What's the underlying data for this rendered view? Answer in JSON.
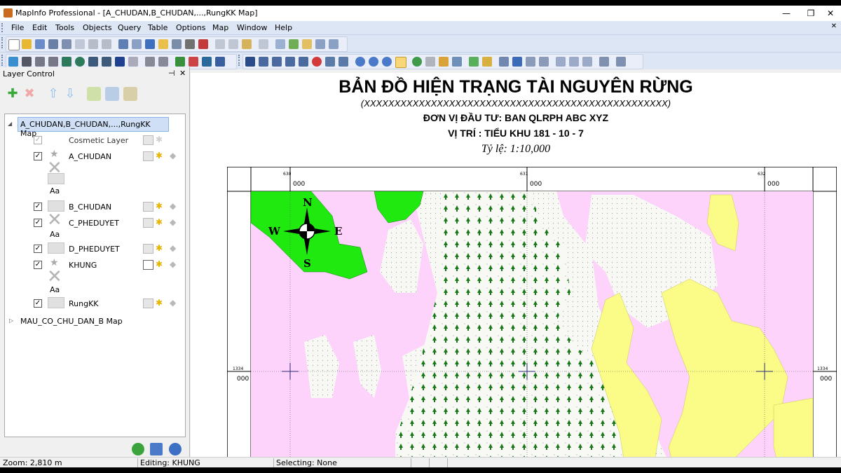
{
  "window": {
    "title": "MapInfo Professional - [A_CHUDAN,B_CHUDAN,...,RungKK Map]",
    "controls": [
      "—",
      "❐",
      "✕"
    ]
  },
  "menu": {
    "items": [
      "File",
      "Edit",
      "Tools",
      "Objects",
      "Query",
      "Table",
      "Options",
      "Map",
      "Window",
      "Help"
    ],
    "mdi_close": "✕"
  },
  "layer_control": {
    "title": "Layer Control",
    "pin": "⊣",
    "close": "✕",
    "map_node": "A_CHUDAN,B_CHUDAN,...,RungKK Map",
    "layers": [
      {
        "name": "Cosmetic Layer",
        "checked": true,
        "disabled": true
      },
      {
        "name": "A_CHUDAN",
        "checked": true
      },
      {
        "name": "B_CHUDAN",
        "checked": true
      },
      {
        "name": "C_PHEDUYET",
        "checked": true
      },
      {
        "name": "D_PHEDUYET",
        "checked": true
      },
      {
        "name": "KHUNG",
        "checked": true
      },
      {
        "name": "RungKK",
        "checked": true
      }
    ],
    "second_map": "MAU_CO_CHU_DAN_B Map",
    "style_aa": "Aa"
  },
  "map": {
    "title": "BẢN ĐỒ HIỆN TRẠNG TÀI NGUYÊN RỪNG",
    "placeholder": "(XXXXXXXXXXXXXXXXXXXXXXXXXXXXXXXXXXXXXXXXXXXXXXXXXX)",
    "investor": "ĐƠN VỊ ĐẦU TƯ: BAN QLRPH ABC XYZ",
    "location": "VỊ TRÍ : TIỂU KHU 181 - 10 - 7",
    "scale": "Tỷ lệ: 1:10,000",
    "grid": {
      "top_small": [
        "630",
        "631",
        "632"
      ],
      "top_big": [
        "000",
        "000",
        "000"
      ],
      "left_small": "1334",
      "left_big": "000",
      "right_small": "1334",
      "right_big": "000"
    },
    "compass": {
      "n": "N",
      "s": "S",
      "e": "E",
      "w": "W"
    },
    "colors": {
      "pink": "#fdd3fb",
      "green": "#1fe90f",
      "yellow": "#fbfb87",
      "dotted": "#f8f8f4",
      "tree": "#177a17"
    }
  },
  "status": {
    "zoom": "Zoom: 2,810 m",
    "editing": "Editing: KHUNG",
    "selecting": "Selecting: None"
  }
}
